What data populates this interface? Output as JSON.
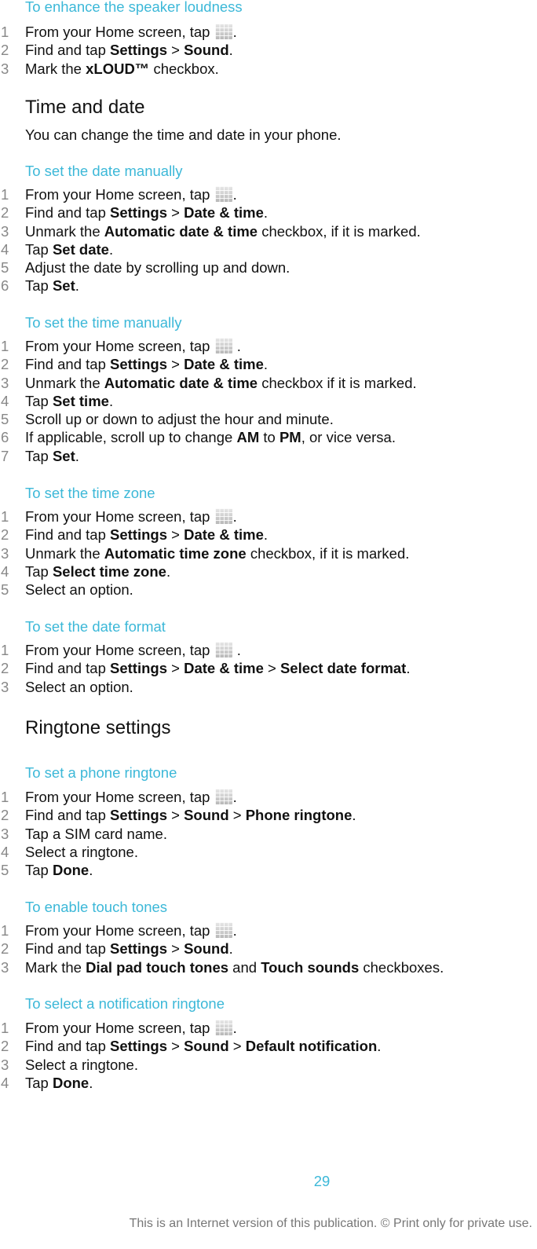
{
  "sections": {
    "speaker": {
      "title": "To enhance the speaker loudness",
      "steps": [
        {
          "n": "1",
          "a": "From your Home screen, tap ",
          "icon": "apps-grid-icon",
          "b": "."
        },
        {
          "n": "2",
          "a": "Find and tap ",
          "s1": "Settings",
          "m1": " > ",
          "s2": "Sound",
          "z": "."
        },
        {
          "n": "3",
          "a": "Mark the ",
          "s1": "xLOUD™",
          "z": " checkbox."
        }
      ]
    },
    "time_and_date": {
      "heading": "Time and date",
      "intro": "You can change the time and date in your phone."
    },
    "date_manual": {
      "title": "To set the date manually",
      "steps": [
        {
          "n": "1",
          "a": "From your Home screen, tap ",
          "b": "."
        },
        {
          "n": "2",
          "a": "Find and tap ",
          "s1": "Settings",
          "m1": " > ",
          "s2": "Date & time",
          "z": "."
        },
        {
          "n": "3",
          "a": "Unmark the ",
          "s1": "Automatic date & time",
          "z": " checkbox, if it is marked."
        },
        {
          "n": "4",
          "a": "Tap ",
          "s1": "Set date",
          "z": "."
        },
        {
          "n": "5",
          "a": "Adjust the date by scrolling up and down."
        },
        {
          "n": "6",
          "a": "Tap ",
          "s1": "Set",
          "z": "."
        }
      ]
    },
    "time_manual": {
      "title": "To set the time manually",
      "steps": [
        {
          "n": "1",
          "a": "From your Home screen, tap ",
          "b": " ."
        },
        {
          "n": "2",
          "a": "Find and tap ",
          "s1": "Settings",
          "m1": " > ",
          "s2": "Date & time",
          "z": "."
        },
        {
          "n": "3",
          "a": "Unmark the ",
          "s1": "Automatic date & time",
          "z": " checkbox if it is marked."
        },
        {
          "n": "4",
          "a": "Tap ",
          "s1": "Set time",
          "z": "."
        },
        {
          "n": "5",
          "a": "Scroll up or down to adjust the hour and minute."
        },
        {
          "n": "6",
          "a": "If applicable, scroll up to change ",
          "s1": "AM",
          "m1": " to ",
          "s2": "PM",
          "z": ", or vice versa."
        },
        {
          "n": "7",
          "a": "Tap ",
          "s1": "Set",
          "z": "."
        }
      ]
    },
    "time_zone": {
      "title": "To set the time zone",
      "steps": [
        {
          "n": "1",
          "a": "From your Home screen, tap ",
          "b": "."
        },
        {
          "n": "2",
          "a": "Find and tap ",
          "s1": "Settings",
          "m1": " > ",
          "s2": "Date & time",
          "z": "."
        },
        {
          "n": "3",
          "a": "Unmark the ",
          "s1": "Automatic time zone",
          "z": " checkbox, if it is marked."
        },
        {
          "n": "4",
          "a": "Tap ",
          "s1": "Select time zone",
          "z": "."
        },
        {
          "n": "5",
          "a": "Select an option."
        }
      ]
    },
    "date_format": {
      "title": "To set the date format",
      "steps": [
        {
          "n": "1",
          "a": "From your Home screen, tap ",
          "b": " ."
        },
        {
          "n": "2",
          "a": "Find and tap ",
          "s1": "Settings",
          "m1": " > ",
          "s2": "Date & time",
          "m2": " > ",
          "s3": "Select date format",
          "z": "."
        },
        {
          "n": "3",
          "a": "Select an option."
        }
      ]
    },
    "ringtone_settings": {
      "heading": "Ringtone settings"
    },
    "phone_ringtone": {
      "title": "To set a phone ringtone",
      "steps": [
        {
          "n": "1",
          "a": "From your Home screen, tap ",
          "b": "."
        },
        {
          "n": "2",
          "a": "Find and tap ",
          "s1": "Settings",
          "m1": " > ",
          "s2": "Sound",
          "m2": " > ",
          "s3": "Phone ringtone",
          "z": "."
        },
        {
          "n": "3",
          "a": "Tap a SIM card name."
        },
        {
          "n": "4",
          "a": "Select a ringtone."
        },
        {
          "n": "5",
          "a": "Tap ",
          "s1": "Done",
          "z": "."
        }
      ]
    },
    "touch_tones": {
      "title": "To enable touch tones",
      "steps": [
        {
          "n": "1",
          "a": "From your Home screen, tap ",
          "b": "."
        },
        {
          "n": "2",
          "a": "Find and tap ",
          "s1": "Settings",
          "m1": " > ",
          "s2": "Sound",
          "z": "."
        },
        {
          "n": "3",
          "a": "Mark the ",
          "s1": "Dial pad touch tones",
          "m1": " and ",
          "s2": "Touch sounds",
          "z": " checkboxes."
        }
      ]
    },
    "notification_ringtone": {
      "title": "To select a notification ringtone",
      "steps": [
        {
          "n": "1",
          "a": "From your Home screen, tap ",
          "b": "."
        },
        {
          "n": "2",
          "a": "Find and tap ",
          "s1": "Settings",
          "m1": " > ",
          "s2": "Sound",
          "m2": " > ",
          "s3": "Default notification",
          "z": "."
        },
        {
          "n": "3",
          "a": "Select a ringtone."
        },
        {
          "n": "4",
          "a": "Tap ",
          "s1": "Done",
          "z": "."
        }
      ]
    }
  },
  "footer": {
    "page_number": "29",
    "notice": "This is an Internet version of this publication. © Print only for private use."
  },
  "colors": {
    "accent": "#3cb8d8",
    "text": "#111111",
    "step_number": "#888888",
    "footer_text": "#777777"
  }
}
